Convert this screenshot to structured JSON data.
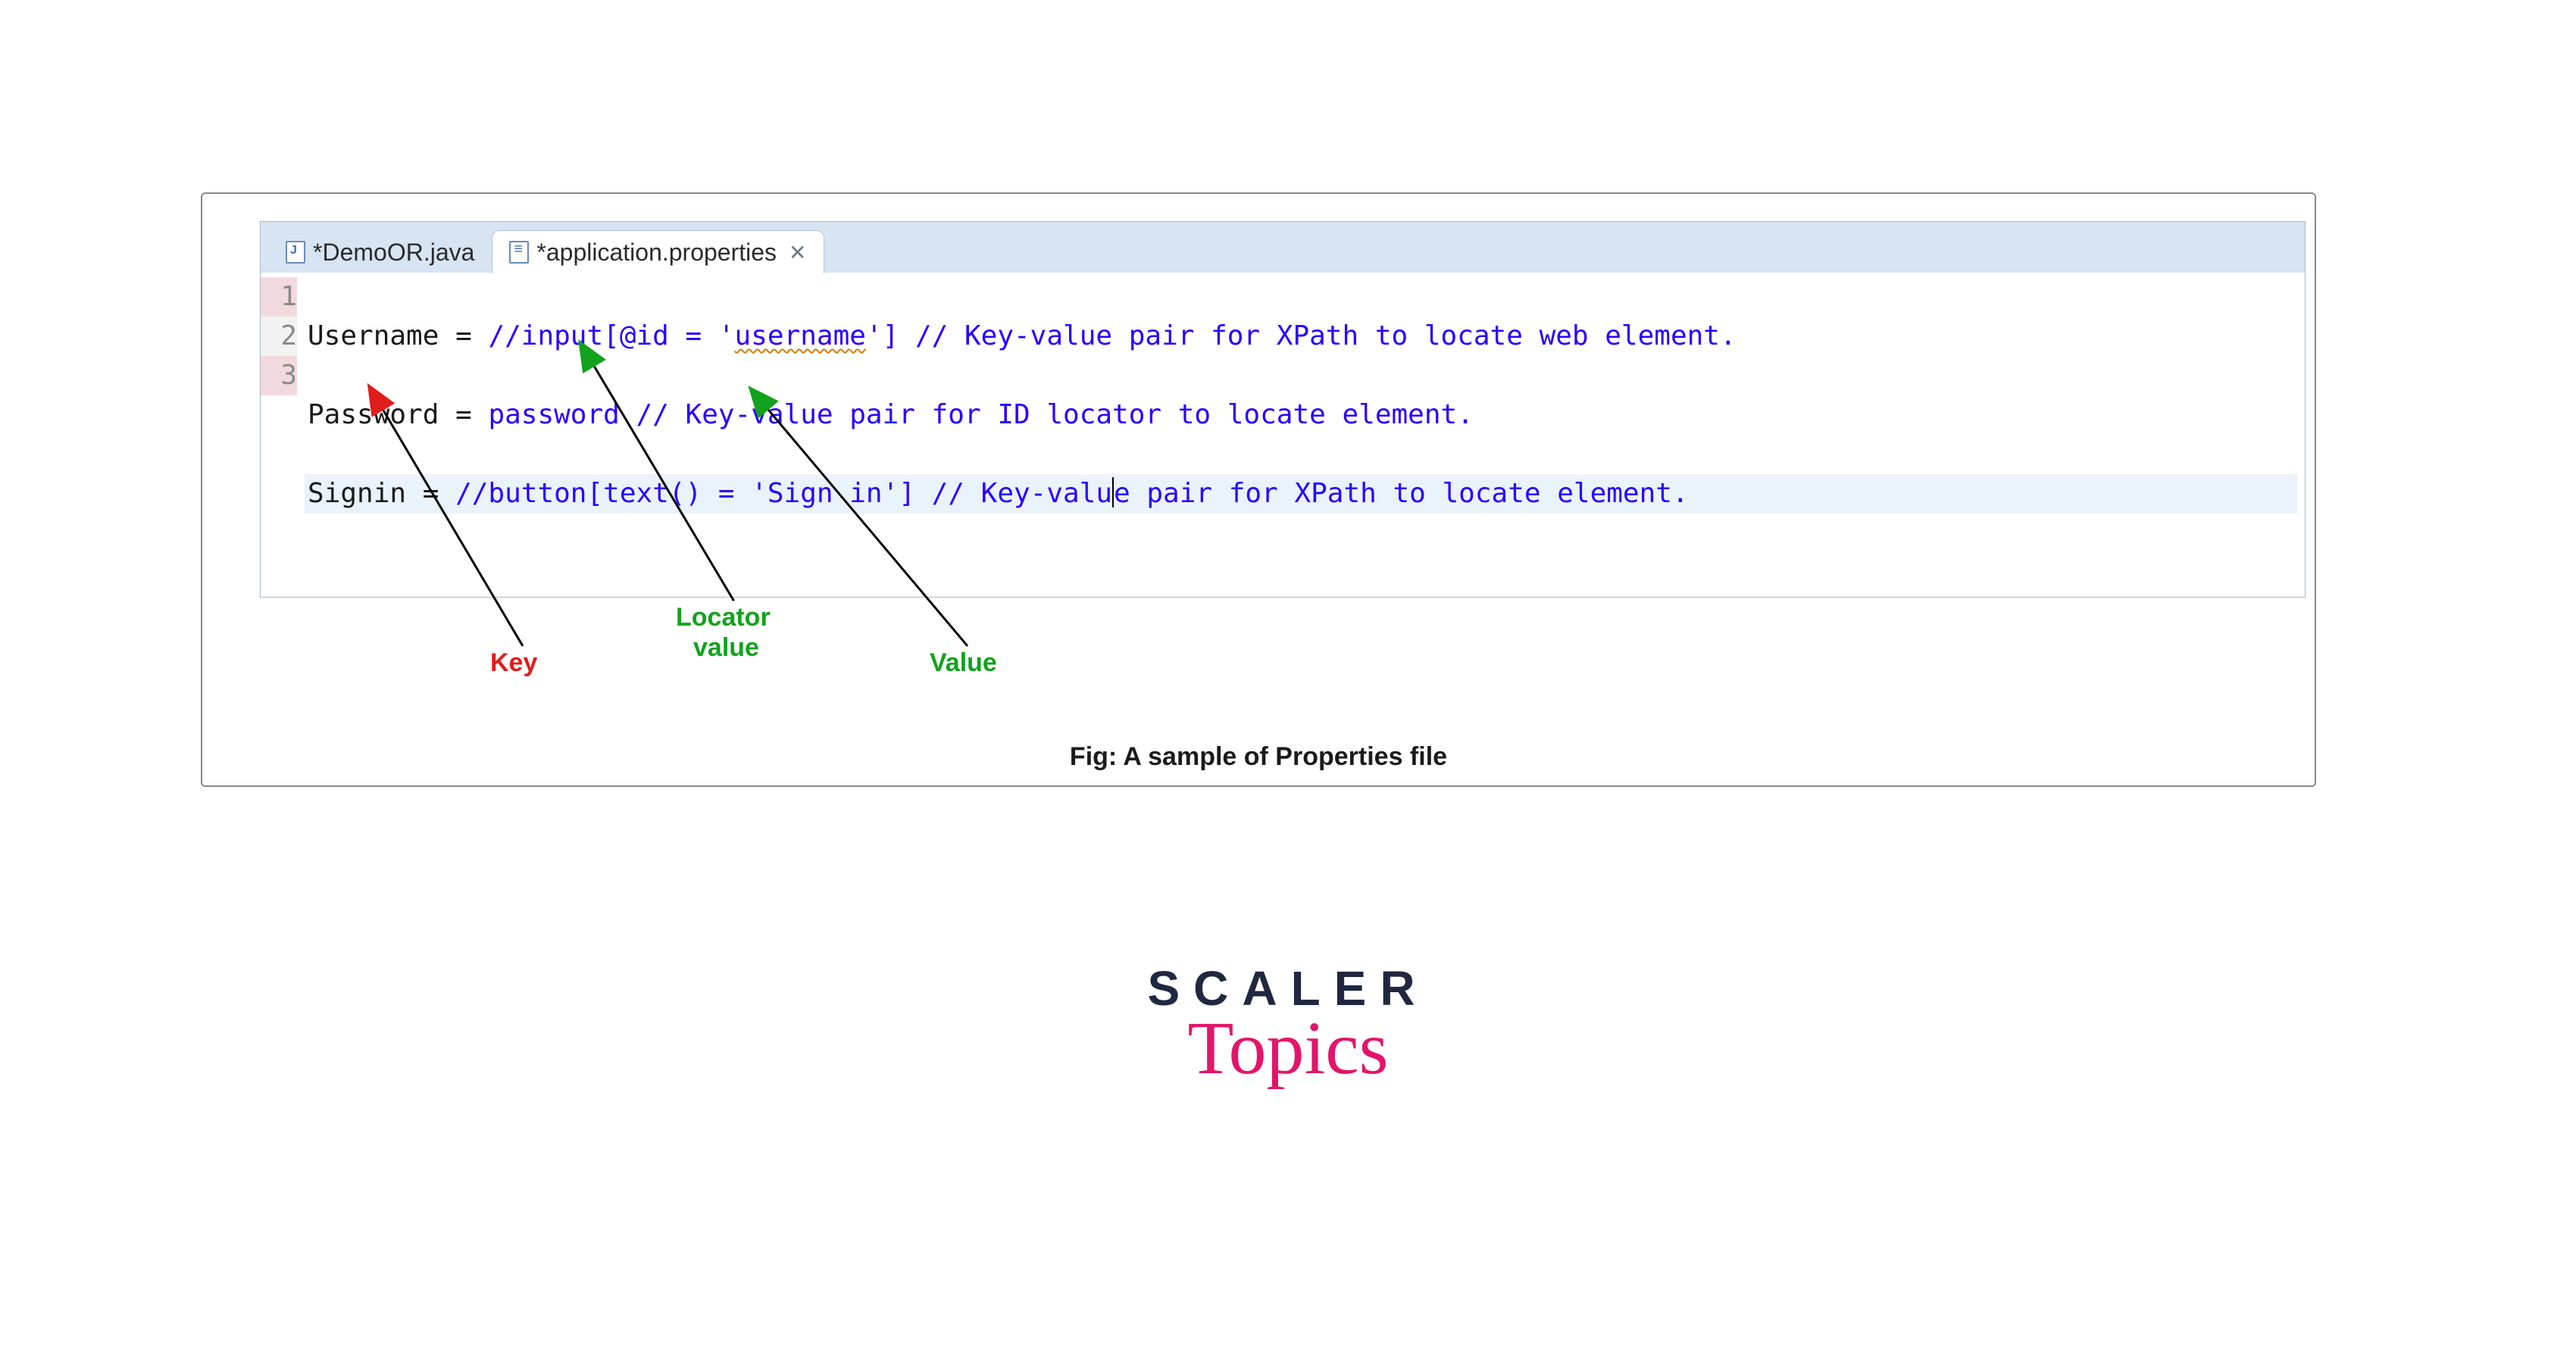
{
  "tabs": {
    "inactive": "*DemoOR.java",
    "active": "*application.properties"
  },
  "gutter": {
    "n1": "1",
    "n2": "2",
    "n3": "3"
  },
  "code": {
    "row1": {
      "key": "Username ",
      "eq": "= ",
      "v1": "//input[@id = '",
      "v2": "username",
      "v3": "'] // Key-value pair for XPath to locate web element."
    },
    "row2": {
      "key": "Password ",
      "eq": "= ",
      "val": "password // Key-value pair for ID locator to locate element."
    },
    "row3": {
      "key": "Signin ",
      "eq": "= ",
      "v_before": "//button[text() = 'Sign in'] // Key-valu",
      "v_after": "e pair for XPath to locate element."
    }
  },
  "caption": "Fig: A sample of Properties file",
  "annot": {
    "key": "Key",
    "loc1": "Locator",
    "loc2": "value",
    "val": "Value"
  },
  "brand": {
    "scaler": "SCALER",
    "topics": "Topics"
  }
}
